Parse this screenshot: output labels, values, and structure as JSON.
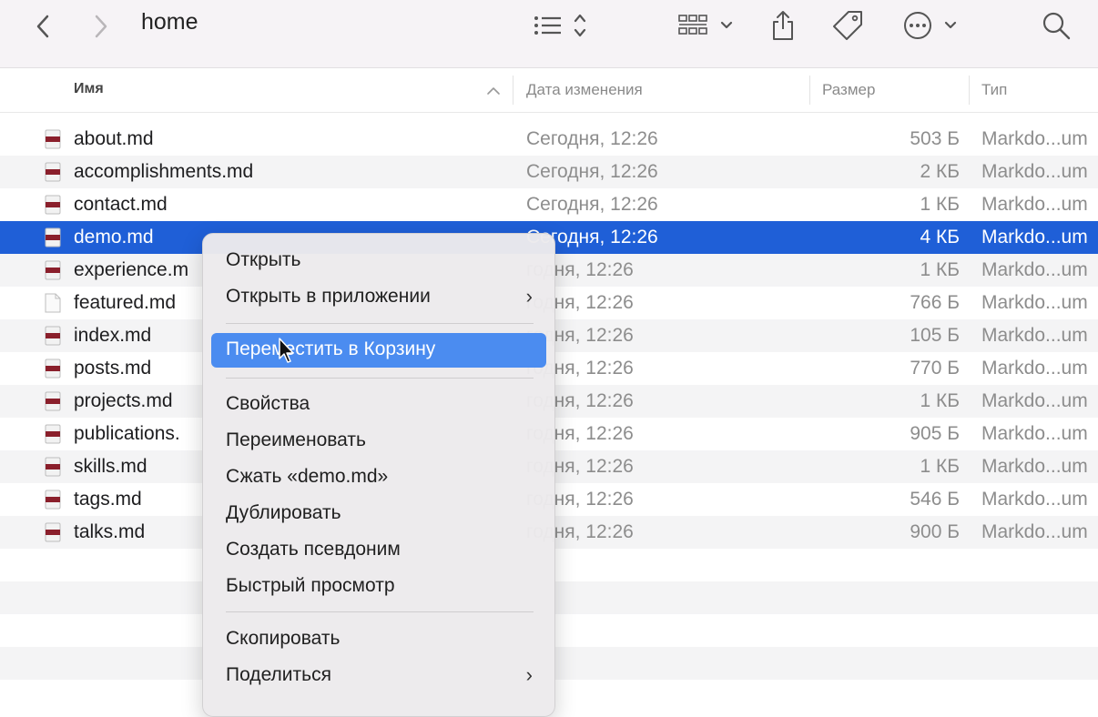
{
  "toolbar": {
    "title": "home",
    "icons": [
      "chevron-left-icon",
      "chevron-right-icon",
      "list-view-icon",
      "grid-view-icon",
      "share-icon",
      "tag-icon",
      "more-actions-icon",
      "search-icon"
    ]
  },
  "columns": {
    "name": "Имя",
    "date": "Дата изменения",
    "size": "Размер",
    "kind": "Тип"
  },
  "files": [
    {
      "name": "about.md",
      "date": "Сегодня, 12:26",
      "size": "503 Б",
      "kind": "Markdo...um"
    },
    {
      "name": "accomplishments.md",
      "date": "Сегодня, 12:26",
      "size": "2 КБ",
      "kind": "Markdo...um"
    },
    {
      "name": "contact.md",
      "date": "Сегодня, 12:26",
      "size": "1 КБ",
      "kind": "Markdo...um"
    },
    {
      "name": "demo.md",
      "date": "Сегодня, 12:26",
      "size": "4 КБ",
      "kind": "Markdo...um",
      "selected": true
    },
    {
      "name": "experience.m",
      "date": "годня, 12:26",
      "size": "1 КБ",
      "kind": "Markdo...um"
    },
    {
      "name": "featured.md",
      "date": "годня, 12:26",
      "size": "766 Б",
      "kind": "Markdo...um"
    },
    {
      "name": "index.md",
      "date": "годня, 12:26",
      "size": "105 Б",
      "kind": "Markdo...um"
    },
    {
      "name": "posts.md",
      "date": "годня, 12:26",
      "size": "770 Б",
      "kind": "Markdo...um"
    },
    {
      "name": "projects.md",
      "date": "годня, 12:26",
      "size": "1 КБ",
      "kind": "Markdo...um"
    },
    {
      "name": "publications.",
      "date": "годня, 12:26",
      "size": "905 Б",
      "kind": "Markdo...um"
    },
    {
      "name": "skills.md",
      "date": "годня, 12:26",
      "size": "1 КБ",
      "kind": "Markdo...um"
    },
    {
      "name": "tags.md",
      "date": "годня, 12:26",
      "size": "546 Б",
      "kind": "Markdo...um"
    },
    {
      "name": "talks.md",
      "date": "годня, 12:26",
      "size": "900 Б",
      "kind": "Markdo...um"
    }
  ],
  "context_menu": {
    "open": "Открыть",
    "open_with": "Открыть в приложении",
    "move_to_trash": "Переместить в Корзину",
    "get_info": "Свойства",
    "rename": "Переименовать",
    "compress": "Сжать «demo.md»",
    "duplicate": "Дублировать",
    "make_alias": "Создать псевдоним",
    "quick_look": "Быстрый просмотр",
    "copy": "Скопировать",
    "share": "Поделиться"
  },
  "colors": {
    "selection": "#1f5fd7",
    "menu_highlight": "#4b8cf0",
    "toolbar_bg": "#f6f3f6"
  }
}
